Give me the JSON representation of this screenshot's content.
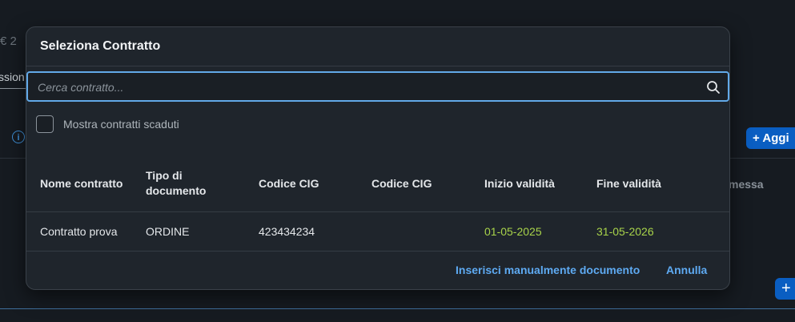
{
  "background": {
    "top_text": "€ 2",
    "field_text": "ssion",
    "info_icon": "info-icon",
    "add_button_label": "Aggi",
    "column_fragment": "messa",
    "plus_button_icon": "plus-icon"
  },
  "dialog": {
    "title": "Seleziona Contratto",
    "search": {
      "placeholder": "Cerca contratto...",
      "value": "",
      "icon": "search-icon"
    },
    "checkbox_label": "Mostra contratti scaduti",
    "columns": [
      "Nome contratto",
      "Tipo di documento",
      "Codice CIG",
      "Codice CIG",
      "Inizio validità",
      "Fine validità"
    ],
    "rows": [
      {
        "name": "Contratto prova",
        "type": "ORDINE",
        "cig1": "423434234",
        "cig2": "",
        "start": "01-05-2025",
        "end": "31-05-2026"
      }
    ],
    "manual_button": "Inserisci manualmente documento",
    "cancel_button": "Annulla"
  },
  "colors": {
    "accent": "#5eaaf2",
    "date_green": "#a8d34a",
    "dialog_bg": "#1f252c",
    "page_bg": "#161b21",
    "focus_border": "#62a9e8"
  }
}
